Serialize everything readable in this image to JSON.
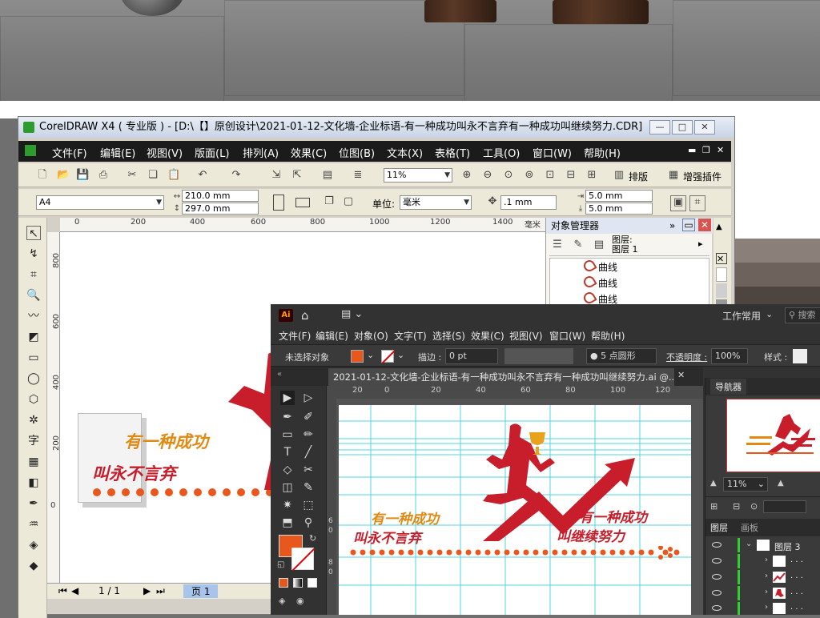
{
  "corel": {
    "title": "CorelDRAW X4 ( 专业版 ) - [D:\\【】原创设计\\2021-01-12-文化墙-企业标语-有一种成功叫永不言弃有一种成功叫继续努力.CDR]",
    "window_buttons": [
      "—",
      "□",
      "✕"
    ],
    "menu": [
      "文件(F)",
      "编辑(E)",
      "视图(V)",
      "版面(L)",
      "排列(A)",
      "效果(C)",
      "位图(B)",
      "文本(X)",
      "表格(T)",
      "工具(O)",
      "窗口(W)",
      "帮助(H)"
    ],
    "zoom": "11%",
    "arrange_label": "排版",
    "enhance_plugin_label": "增强插件",
    "page_size": "A4",
    "width": "210.0 mm",
    "height": "297.0 mm",
    "unit_label": "单位:",
    "unit": "毫米",
    "nudge": ".1 mm",
    "dup_x": "5.0 mm",
    "dup_y": "5.0 mm",
    "ruler_h": [
      "0",
      "200",
      "400",
      "600",
      "800",
      "1000",
      "1200",
      "1400",
      "毫米"
    ],
    "ruler_v": [
      "800",
      "600",
      "400",
      "200",
      "0"
    ],
    "page_nav": "1 / 1",
    "page_tab": "页 1",
    "docker": {
      "title": "对象管理器",
      "layer_label_1": "图层:",
      "layer_label_2": "图层 1",
      "items": [
        "曲线",
        "曲线",
        "曲线"
      ]
    },
    "slogan_line1": "有一种成功",
    "slogan_line2": "叫永不言弃"
  },
  "ai": {
    "logo": "Ai",
    "workspace": "工作常用",
    "search_placeholder": "搜索",
    "menu": [
      "文件(F)",
      "编辑(E)",
      "对象(O)",
      "文字(T)",
      "选择(S)",
      "效果(C)",
      "视图(V)",
      "窗口(W)",
      "帮助(H)"
    ],
    "no_selection": "未选择对象",
    "stroke_label": "描边 :",
    "stroke_value": "0 pt",
    "brush": "5 点圆形",
    "opacity_label": "不透明度 :",
    "opacity_value": "100%",
    "style_label": "样式 :",
    "doc_tab": "2021-01-12-文化墙-企业标语-有一种成功叫永不言弃有一种成功叫继续努力.ai @...",
    "ruler_h": [
      "20",
      "0",
      "20",
      "40",
      "60",
      "80",
      "100",
      "120"
    ],
    "ruler_v": [
      "6",
      "0",
      "8",
      "0"
    ],
    "navigator_tab": "导航器",
    "nav_zoom": "11%",
    "layers_tab": "图层",
    "artboard_tab": "画板",
    "layer_name": "图层 3",
    "sublayers": [
      ". . .",
      ". . .",
      ". . .",
      ". . ."
    ],
    "art": {
      "left_line1": "有一种成功",
      "left_line2": "叫永不言弃",
      "right_line1": "有一种成功",
      "right_line2": "叫继续努力"
    }
  },
  "colors": {
    "accent_red": "#c81e2b",
    "accent_orange": "#e07a1a",
    "ai_fill": "#e8571b"
  }
}
